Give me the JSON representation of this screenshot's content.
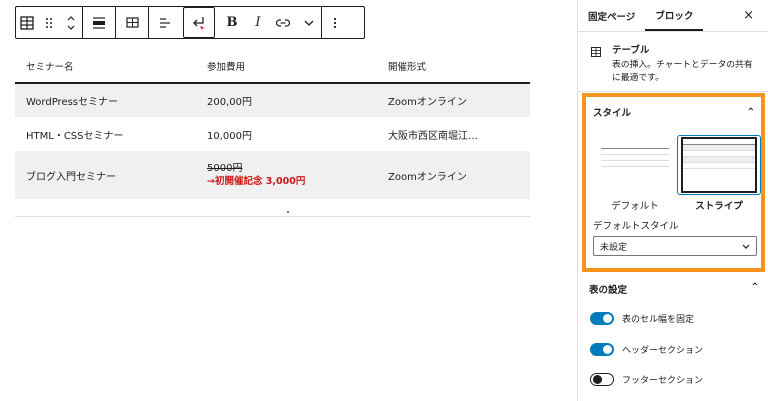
{
  "toolbar": {
    "icons": [
      "table-icon",
      "drag-handle-icon",
      "move-up-down-icon",
      "align-wide-icon",
      "edit-table-icon",
      "align-text-icon",
      "enter-icon",
      "bold",
      "italic",
      "link-icon",
      "chevron-down-icon",
      "more-options-icon"
    ],
    "bold_label": "B",
    "italic_label": "I"
  },
  "table": {
    "headers": [
      "セミナー名",
      "参加費用",
      "開催形式"
    ],
    "rows": [
      {
        "name": "WordPressセミナー",
        "price": "200,00円",
        "format": "Zoomオンライン"
      },
      {
        "name": "HTML・CSSセミナー",
        "price": "10,000円",
        "format": "大阪市西区南堀江…"
      },
      {
        "name": "ブログ入門セミナー",
        "price_old": "5000円",
        "price_new": "→初開催記念 3,000円",
        "format": "Zoomオンライン"
      }
    ]
  },
  "sidebar": {
    "tabs": [
      "固定ページ",
      "ブロック"
    ],
    "active_tab": "ブロック",
    "close": "×",
    "block": {
      "title": "テーブル",
      "description": "表の挿入。チャートとデータの共有に最適です。"
    },
    "styles": {
      "heading": "スタイル",
      "options": [
        "デフォルト",
        "ストライプ"
      ],
      "selected": "ストライプ",
      "default_style_label": "デフォルトスタイル",
      "default_style_value": "未設定"
    },
    "settings": {
      "heading": "表の設定",
      "toggles": [
        {
          "label": "表のセル幅を固定",
          "on": true
        },
        {
          "label": "ヘッダーセクション",
          "on": true
        },
        {
          "label": "フッターセクション",
          "on": false
        }
      ]
    }
  },
  "colors": {
    "accent": "#007cba",
    "highlight_border": "#f7941d",
    "sale_red": "#cc1818",
    "stripe": "#f0f0f0"
  }
}
